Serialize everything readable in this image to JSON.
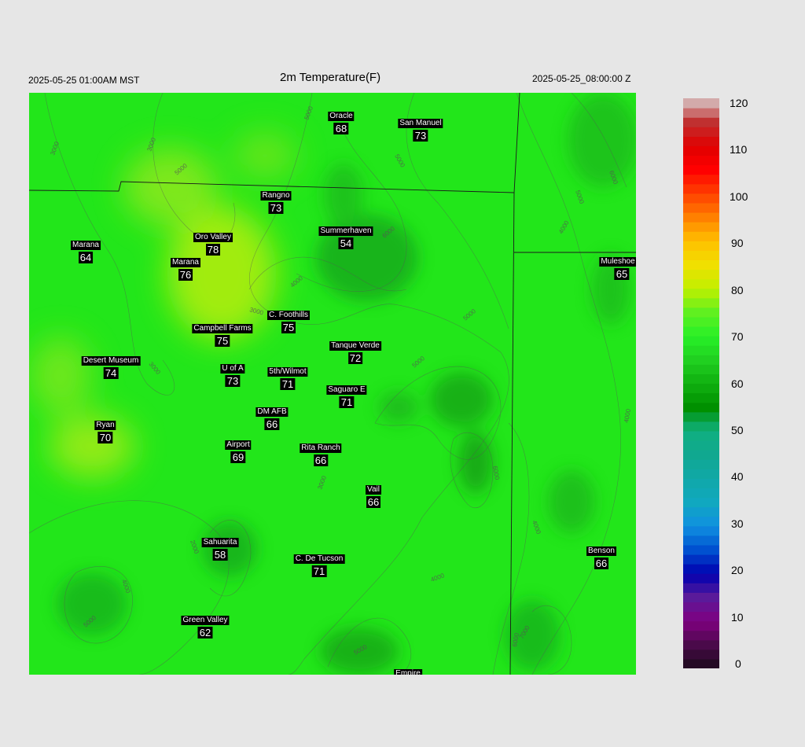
{
  "header": {
    "valid_time": "2025-05-25 01:00AM MST",
    "title": "2m Temperature(F)",
    "init_time": "2025-05-25_08:00:00 Z"
  },
  "colors": {
    "background": "#e6e6e6",
    "field_base": "#22e61a",
    "field_warm": "#a8ec12",
    "field_cool": "#129c18",
    "contour": "#555555",
    "station_bg": "#000000",
    "station_text": "#ffffff"
  },
  "colorbar": {
    "min": 0,
    "max": 120,
    "ticks": [
      "0",
      "10",
      "20",
      "30",
      "40",
      "50",
      "60",
      "70",
      "80",
      "90",
      "100",
      "110",
      "120"
    ]
  },
  "contour_labels": [
    "2000",
    "3000",
    "4000",
    "5000",
    "6000",
    "7000",
    "8000"
  ],
  "stations": [
    {
      "name": "Oracle",
      "value": "68"
    },
    {
      "name": "San Manuel",
      "value": "73"
    },
    {
      "name": "Rangno",
      "value": "73"
    },
    {
      "name": "Summerhaven",
      "value": "54"
    },
    {
      "name": "Marana",
      "value": "64"
    },
    {
      "name": "Oro Valley",
      "value": "78"
    },
    {
      "name": "Marana",
      "value": "76"
    },
    {
      "name": "Muleshoe R",
      "value": "65"
    },
    {
      "name": "C. Foothills",
      "value": "75"
    },
    {
      "name": "Campbell Farms",
      "value": "75"
    },
    {
      "name": "Tanque Verde",
      "value": "72"
    },
    {
      "name": "Desert Museum",
      "value": "74"
    },
    {
      "name": "U of A",
      "value": "73"
    },
    {
      "name": "5th/Wilmot",
      "value": "71"
    },
    {
      "name": "Saguaro E",
      "value": "71"
    },
    {
      "name": "DM AFB",
      "value": "66"
    },
    {
      "name": "Ryan",
      "value": "70"
    },
    {
      "name": "Airport",
      "value": "69"
    },
    {
      "name": "Rita Ranch",
      "value": "66"
    },
    {
      "name": "Vail",
      "value": "66"
    },
    {
      "name": "Sahuarita",
      "value": "58"
    },
    {
      "name": "C. De Tucson",
      "value": "71"
    },
    {
      "name": "Benson",
      "value": "66"
    },
    {
      "name": "Green Valley",
      "value": "62"
    },
    {
      "name": "Empire",
      "value": ""
    }
  ]
}
